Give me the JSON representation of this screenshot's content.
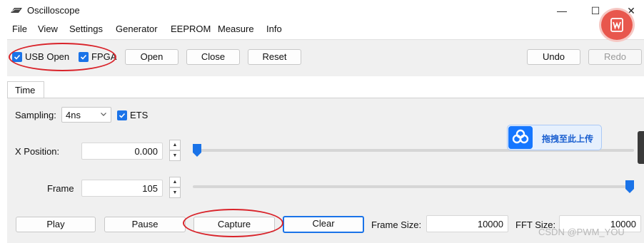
{
  "window": {
    "title": "Oscilloscope",
    "minimize_glyph": "—",
    "maximize_glyph": "☐",
    "close_glyph": "✕"
  },
  "menu": [
    "File",
    "View",
    "Settings",
    "Generator",
    "EEPROM",
    "Measure",
    "Info"
  ],
  "toolbar": {
    "usb_open_label": "USB Open",
    "usb_open_checked": true,
    "fpga_label": "FPGA",
    "fpga_checked": true,
    "open_label": "Open",
    "close_label": "Close",
    "reset_label": "Reset",
    "undo_label": "Undo",
    "redo_label": "Redo"
  },
  "tabs": [
    "Time"
  ],
  "time": {
    "sampling_label": "Sampling:",
    "sampling_value": "4ns",
    "ets_label": "ETS",
    "ets_checked": true,
    "x_position_label": "X Position:",
    "x_position_value": "0.000",
    "x_position_fraction": 0.0,
    "frame_label": "Frame",
    "frame_value": "105",
    "frame_fraction": 1.0,
    "play_label": "Play",
    "pause_label": "Pause",
    "capture_label": "Capture",
    "clear_label": "Clear",
    "frame_size_label": "Frame Size:",
    "frame_size_value": "10000",
    "fft_size_label": "FFT Size:",
    "fft_size_value": "10000"
  },
  "overlays": {
    "upload_text": "拖拽至此上传",
    "watermark": "CSDN @PWM_YOU"
  },
  "colors": {
    "accent": "#1a73e8",
    "annotation_red": "#d9232a",
    "panel_bg": "#f0f0f0"
  },
  "icons": [
    "app-icon",
    "checkmark-icon",
    "chevron-down-icon",
    "spin-up-icon",
    "spin-down-icon",
    "slider-thumb-icon",
    "cloud-upload-icon",
    "wps-icon"
  ]
}
